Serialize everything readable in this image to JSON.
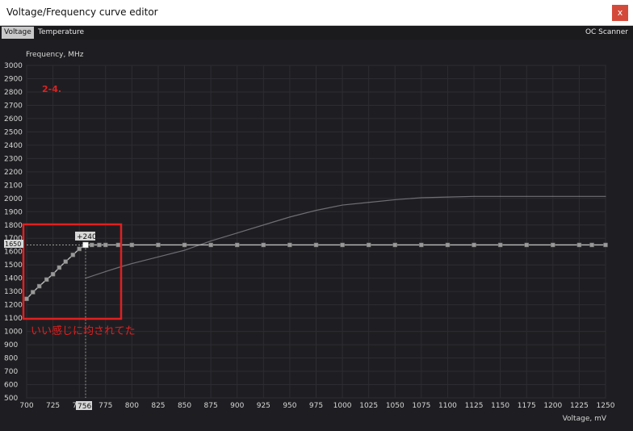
{
  "window": {
    "title": "Voltage/Frequency curve editor",
    "close_label": "x"
  },
  "tabs": [
    {
      "label": "Voltage",
      "active": true
    },
    {
      "label": "Temperature",
      "active": false
    }
  ],
  "oc_scanner_label": "OC Scanner",
  "annotations": {
    "step_label": "2-4.",
    "note": "いい感じに均されてた",
    "offset_badge": "+240",
    "current_freq_label": "1650",
    "current_voltage_label": "756"
  },
  "colors": {
    "background": "#1e1e22",
    "grid": "#2c2c32",
    "curve": "#6e6e74",
    "points": "#9a9a9a",
    "highlight": "#e02020"
  },
  "chart_data": {
    "type": "line",
    "xlabel": "Voltage, mV",
    "ylabel": "Frequency, MHz",
    "xlim": [
      700,
      1250
    ],
    "ylim": [
      500,
      3000
    ],
    "xticks": [
      700,
      725,
      750,
      775,
      800,
      825,
      850,
      875,
      900,
      925,
      950,
      975,
      1000,
      1025,
      1050,
      1075,
      1100,
      1125,
      1150,
      1175,
      1200,
      1225,
      1250
    ],
    "yticks": [
      500,
      600,
      700,
      800,
      900,
      1000,
      1100,
      1200,
      1300,
      1400,
      1500,
      1600,
      1700,
      1800,
      1900,
      2000,
      2100,
      2200,
      2300,
      2400,
      2500,
      2600,
      2700,
      2800,
      2900,
      3000
    ],
    "grid": true,
    "series": [
      {
        "name": "",
        "role": "default-curve",
        "x": [
          756,
          775,
          787,
          800,
          825,
          850,
          875,
          900,
          925,
          950,
          975,
          1000,
          1025,
          1050,
          1075,
          1100,
          1125,
          1150,
          1175,
          1200,
          1225,
          1250
        ],
        "y": [
          1400,
          1450,
          1480,
          1510,
          1560,
          1610,
          1680,
          1740,
          1800,
          1860,
          1910,
          1950,
          1970,
          1990,
          2005,
          2010,
          2015,
          2015,
          2015,
          2015,
          2015,
          2015
        ]
      },
      {
        "name": "",
        "role": "edited-points",
        "x": [
          700,
          706,
          712,
          719,
          725,
          731,
          737,
          744,
          750,
          756,
          762,
          769,
          775,
          787,
          800,
          825,
          850,
          875,
          900,
          925,
          950,
          975,
          1000,
          1025,
          1050,
          1075,
          1100,
          1125,
          1150,
          1175,
          1200,
          1225,
          1237,
          1250
        ],
        "y": [
          1245,
          1295,
          1340,
          1390,
          1430,
          1480,
          1525,
          1575,
          1620,
          1650,
          1650,
          1650,
          1650,
          1650,
          1650,
          1650,
          1650,
          1650,
          1650,
          1650,
          1650,
          1650,
          1650,
          1650,
          1650,
          1650,
          1650,
          1650,
          1650,
          1650,
          1650,
          1650,
          1650,
          1650
        ]
      }
    ],
    "current_point": {
      "x": 756,
      "y": 1650
    }
  }
}
